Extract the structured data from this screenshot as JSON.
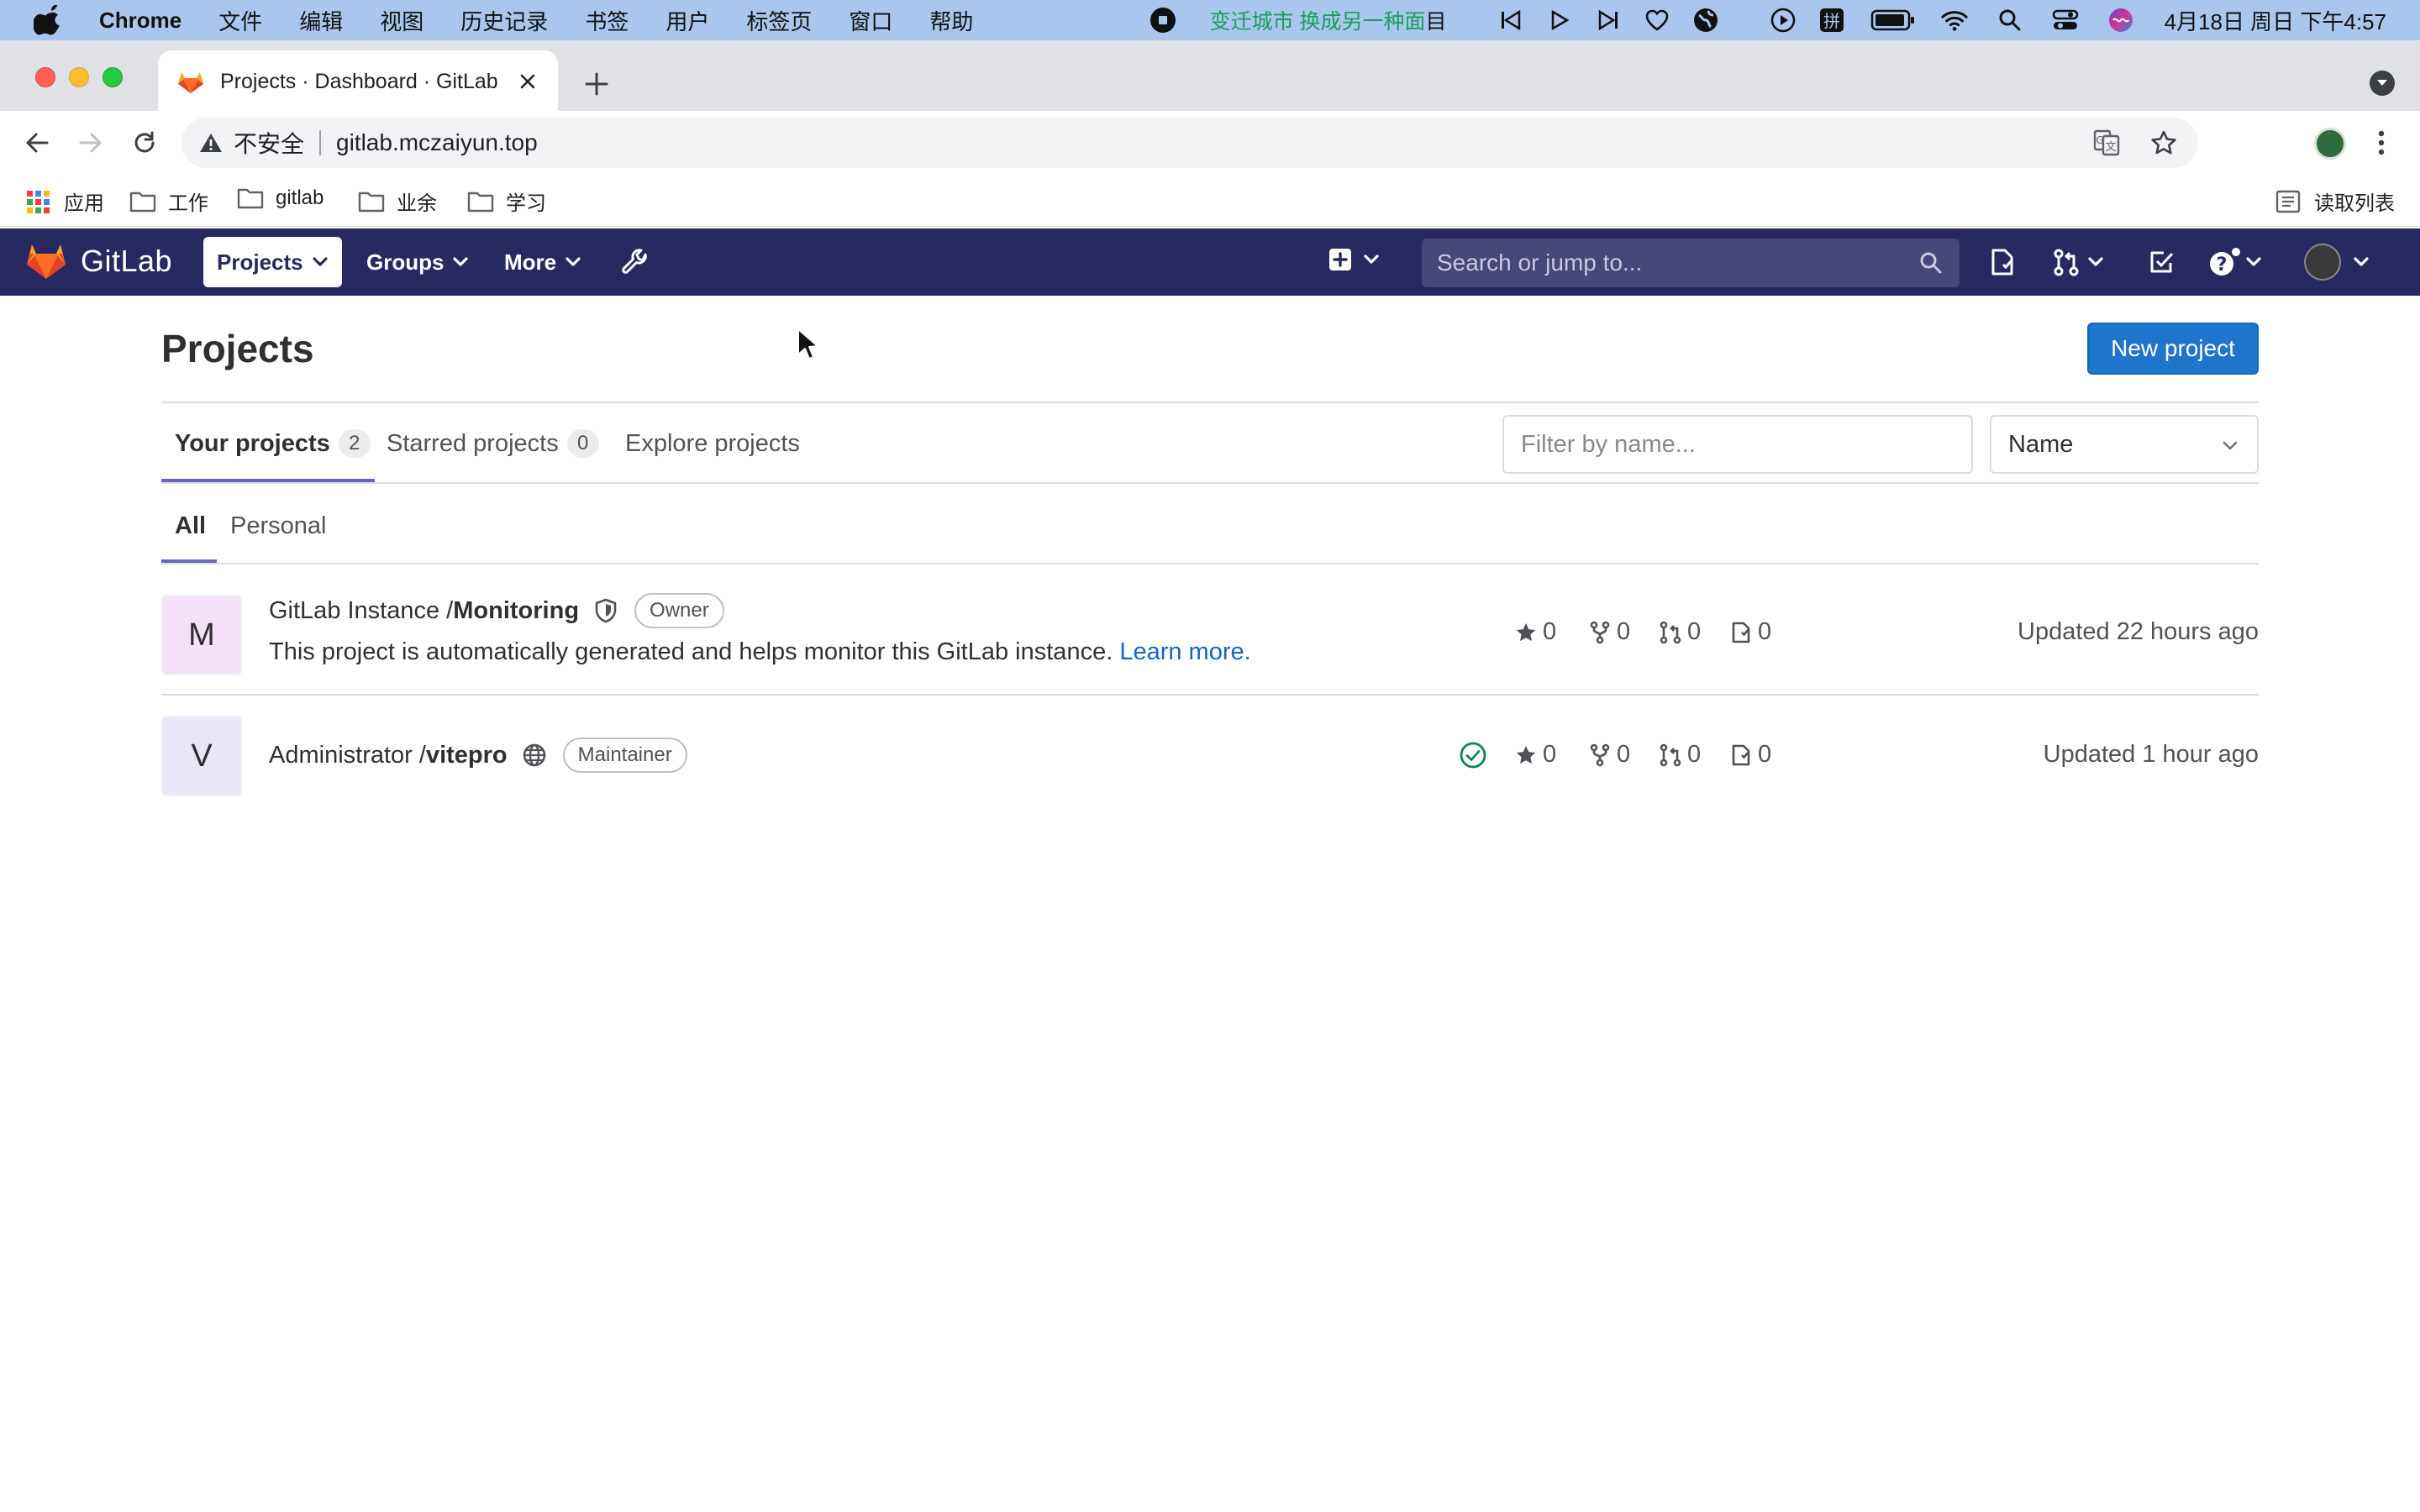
{
  "menubar": {
    "app_name": "Chrome",
    "items": [
      "文件",
      "编辑",
      "视图",
      "历史记录",
      "书签",
      "用户",
      "标签页",
      "窗口",
      "帮助"
    ],
    "music_text": "变迁城市 换成另一种面",
    "music_suffix": "目",
    "clock": "4月18日 周日 下午4:57",
    "icons": [
      "apple-icon",
      "stop-icon",
      "previous-icon",
      "play-icon",
      "next-icon",
      "heart-icon",
      "globe-icon",
      "media-icon",
      "input-method-icon",
      "battery-icon",
      "wifi-icon",
      "search-icon",
      "control-center-icon",
      "siri-icon"
    ]
  },
  "browser": {
    "tab_title": "Projects · Dashboard · GitLab",
    "insecure_label": "不安全",
    "url": "gitlab.mczaiyun.top",
    "bookmarks": [
      {
        "label": "应用",
        "icon": "apps-grid-icon"
      },
      {
        "label": "工作",
        "icon": "folder-icon"
      },
      {
        "label": "gitlab",
        "icon": "folder-icon"
      },
      {
        "label": "业余",
        "icon": "folder-icon"
      },
      {
        "label": "学习",
        "icon": "folder-icon"
      }
    ],
    "reading_list": "读取列表"
  },
  "gitlab_nav": {
    "wordmark": "GitLab",
    "projects": "Projects",
    "groups": "Groups",
    "more": "More",
    "search_placeholder": "Search or jump to..."
  },
  "page": {
    "title": "Projects",
    "new_project": "New project",
    "tabs": [
      {
        "label": "Your projects",
        "count": "2"
      },
      {
        "label": "Starred projects",
        "count": "0"
      },
      {
        "label": "Explore projects"
      }
    ],
    "filter_placeholder": "Filter by name...",
    "sort_value": "Name",
    "subtabs": [
      "All",
      "Personal"
    ]
  },
  "projects": [
    {
      "avatar_letter": "M",
      "avatar_color": "#f4e1f7",
      "namespace": "GitLab Instance / ",
      "name": "Monitoring",
      "visibility_icon": "shield-icon",
      "role": "Owner",
      "description": "This project is automatically generated and helps monitor this GitLab instance. ",
      "learn_more": "Learn more.",
      "stars": "0",
      "forks": "0",
      "merge_requests": "0",
      "issues": "0",
      "updated": "Updated 22 hours ago"
    },
    {
      "avatar_letter": "V",
      "avatar_color": "#e7e7f7",
      "namespace": "Administrator / ",
      "name": "vitepro",
      "visibility_icon": "globe-icon",
      "role": "Maintainer",
      "pipeline_status": "passed",
      "stars": "0",
      "forks": "0",
      "merge_requests": "0",
      "issues": "0",
      "updated": "Updated 1 hour ago"
    }
  ],
  "colors": {
    "navbar": "#292961",
    "primary_button": "#1f75cb",
    "tab_underline": "#6666c4",
    "pipeline_success": "#108548"
  }
}
